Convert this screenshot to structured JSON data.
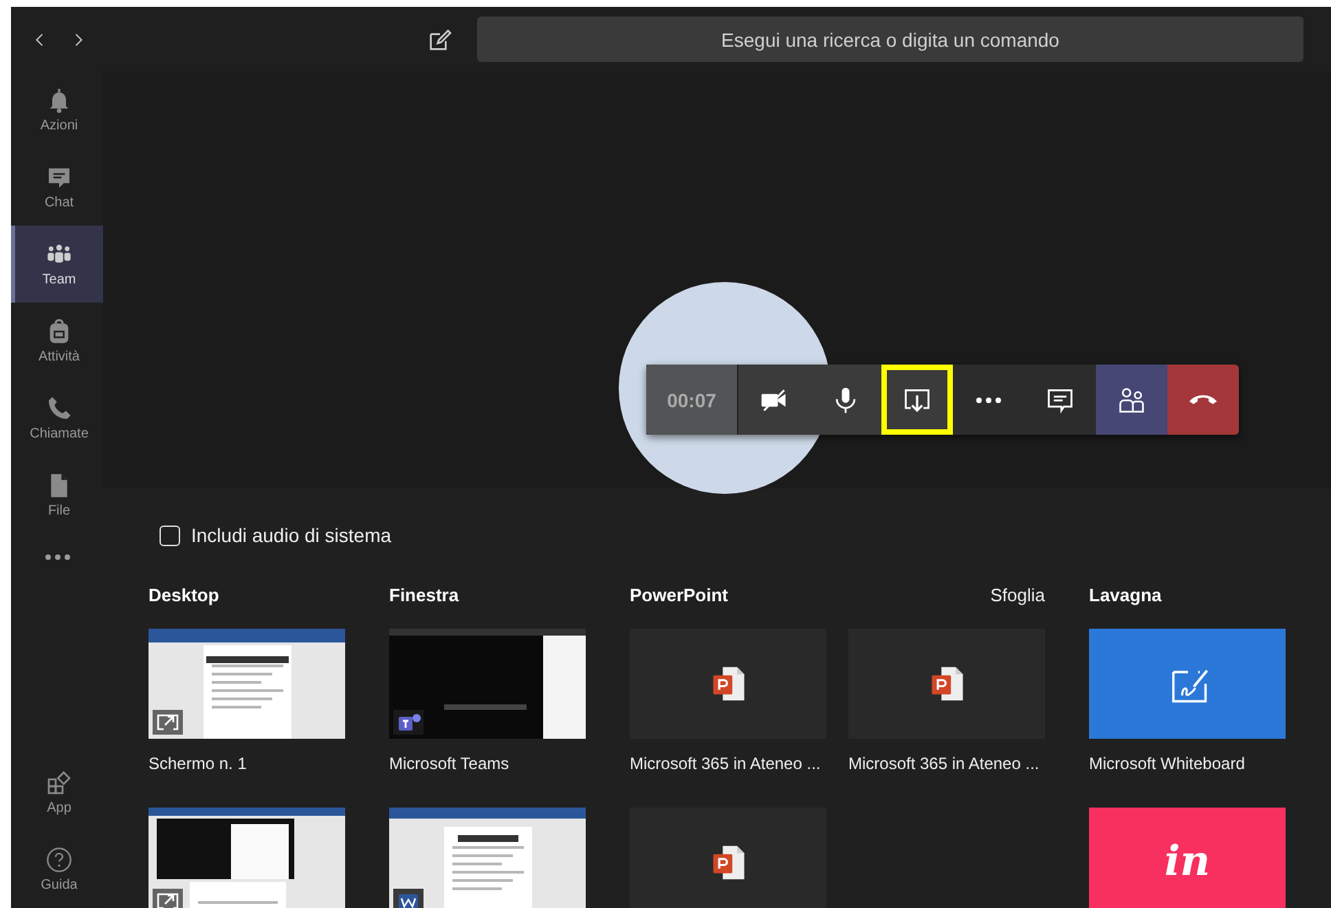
{
  "title_bar": {
    "search": {
      "placeholder": "Esegui una ricerca o digita un comando"
    }
  },
  "sidebar": {
    "items": [
      {
        "label": "Azioni",
        "selected": false
      },
      {
        "label": "Chat",
        "selected": false
      },
      {
        "label": "Team",
        "selected": true
      },
      {
        "label": "Attività",
        "selected": false
      },
      {
        "label": "Chiamate",
        "selected": false
      },
      {
        "label": "File",
        "selected": false
      }
    ],
    "bottom_items": [
      {
        "label": "App"
      },
      {
        "label": "Guida"
      }
    ]
  },
  "call": {
    "timer": "00:07",
    "buttons": [
      {
        "kind": "camera",
        "on": false,
        "highlighted": false
      },
      {
        "kind": "mic",
        "on": true,
        "highlighted": false
      },
      {
        "kind": "share",
        "highlighted": true
      },
      {
        "kind": "more",
        "highlighted": false
      },
      {
        "kind": "chat",
        "highlighted": false
      },
      {
        "kind": "participants",
        "highlighted": false
      },
      {
        "kind": "hangup",
        "highlighted": false
      }
    ]
  },
  "share_tray": {
    "include_audio": {
      "label": "Includi audio di sistema",
      "checked": false
    },
    "sections": [
      {
        "title": "Desktop",
        "kind": "single",
        "items": [
          {
            "kind": "screen",
            "label": "Schermo n. 1"
          },
          {
            "kind": "screen2"
          }
        ]
      },
      {
        "title": "Finestra",
        "kind": "single",
        "items": [
          {
            "kind": "window",
            "label": "Microsoft Teams"
          },
          {
            "kind": "document"
          }
        ]
      },
      {
        "title": "PowerPoint",
        "kind": "double",
        "link": "Sfoglia",
        "items": [
          {
            "kind": "file",
            "label": "Microsoft 365 in Ateneo ..."
          },
          {
            "kind": "file",
            "label": "Microsoft 365 in Ateneo ..."
          },
          {
            "kind": "file"
          }
        ]
      },
      {
        "title": "Lavagna",
        "kind": "single",
        "items": [
          {
            "kind": "whiteboard",
            "label": "Microsoft Whiteboard"
          },
          {
            "kind": "brand",
            "logo_text": "in"
          }
        ]
      }
    ]
  }
}
